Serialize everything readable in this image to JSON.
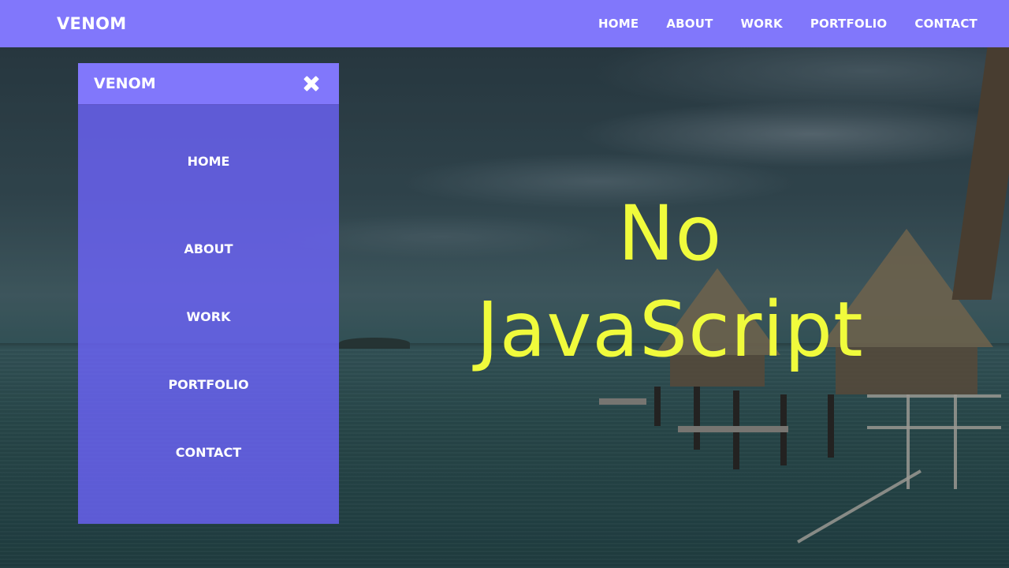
{
  "header": {
    "brand": "VENOM",
    "nav": [
      "HOME",
      "ABOUT",
      "WORK",
      "PORTFOLIO",
      "CONTACT"
    ]
  },
  "drawer": {
    "brand": "VENOM",
    "close_icon": "close-icon",
    "nav": [
      "HOME",
      "ABOUT",
      "WORK",
      "PORTFOLIO",
      "CONTACT"
    ]
  },
  "hero": {
    "line1": "No",
    "line2": "JavaScript"
  },
  "colors": {
    "accent": "#8177fb",
    "drawer": "#6e64ff",
    "headline": "#f0fb3c",
    "text": "#ffffff"
  }
}
